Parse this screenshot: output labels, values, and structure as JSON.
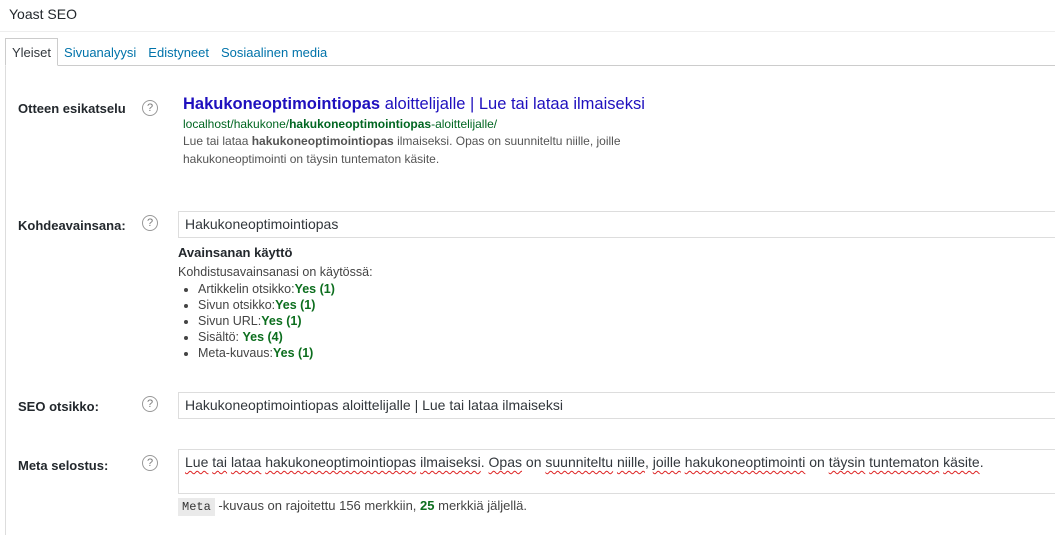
{
  "panel": {
    "title": "Yoast SEO"
  },
  "tabs": [
    {
      "label": "Yleiset",
      "active": true
    },
    {
      "label": "Sivuanalyysi",
      "active": false
    },
    {
      "label": "Edistyneet",
      "active": false
    },
    {
      "label": "Sosiaalinen media",
      "active": false
    }
  ],
  "help_glyph": "?",
  "snippet": {
    "label": "Otteen esikatselu",
    "title_keyword": "Hakukoneoptimointiopas",
    "title_rest": " aloittelijalle | Lue tai lataa ilmaiseksi",
    "url_prefix": "localhost/hakukone/",
    "url_keyword": "hakukoneoptimointiopas",
    "url_suffix": "-aloittelijalle/",
    "desc_prefix": "Lue tai lataa ",
    "desc_keyword": "hakukoneoptimointiopas",
    "desc_rest": " ilmaiseksi. Opas on suunniteltu niille, joille hakukoneoptimointi on täysin tuntematon käsite."
  },
  "focus_keyword": {
    "label": "Kohdeavainsana:",
    "value": "Hakukoneoptimointiopas",
    "usage_title": "Avainsanan käyttö",
    "usage_intro": "Kohdistusavainsanasi on käytössä:",
    "usage_items": [
      {
        "label": "Artikkelin otsikko:",
        "result": "Yes (1)"
      },
      {
        "label": "Sivun otsikko:",
        "result": "Yes (1)"
      },
      {
        "label": "Sivun URL:",
        "result": "Yes (1)"
      },
      {
        "label": "Sisältö: ",
        "result": "Yes (4)"
      },
      {
        "label": "Meta-kuvaus:",
        "result": "Yes (1)"
      }
    ]
  },
  "seo_title": {
    "label": "SEO otsikko:",
    "value": "Hakukoneoptimointiopas aloittelijalle | Lue tai lataa ilmaiseksi"
  },
  "meta": {
    "label": "Meta selostus:",
    "words": [
      {
        "t": "Lue",
        "s": true
      },
      {
        "t": " ",
        "s": false
      },
      {
        "t": "tai",
        "s": true
      },
      {
        "t": " ",
        "s": false
      },
      {
        "t": "lataa",
        "s": true
      },
      {
        "t": " ",
        "s": false
      },
      {
        "t": "hakukoneoptimointiopas",
        "s": true
      },
      {
        "t": " ",
        "s": false
      },
      {
        "t": "ilmaiseksi",
        "s": true
      },
      {
        "t": ". ",
        "s": false
      },
      {
        "t": "Opas",
        "s": true
      },
      {
        "t": " on ",
        "s": false
      },
      {
        "t": "suunniteltu",
        "s": true
      },
      {
        "t": " ",
        "s": false
      },
      {
        "t": "niille",
        "s": true
      },
      {
        "t": ", ",
        "s": false
      },
      {
        "t": "joille",
        "s": true
      },
      {
        "t": " ",
        "s": false
      },
      {
        "t": "hakukoneoptimointi",
        "s": true
      },
      {
        "t": " on ",
        "s": false
      },
      {
        "t": "täysin",
        "s": true
      },
      {
        "t": " ",
        "s": false
      },
      {
        "t": "tuntematon",
        "s": true
      },
      {
        "t": " ",
        "s": false
      },
      {
        "t": "käsite",
        "s": true
      },
      {
        "t": ".",
        "s": false
      }
    ],
    "counter_code": "Meta",
    "counter_text": " -kuvaus on rajoitettu 156 merkkiin, ",
    "counter_remaining": "25",
    "counter_suffix": " merkkiä jäljellä."
  },
  "colors": {
    "link": "#0073aa",
    "snippet_title": "#1e0fbe",
    "snippet_url": "#006621",
    "good": "#0c6e1e"
  }
}
